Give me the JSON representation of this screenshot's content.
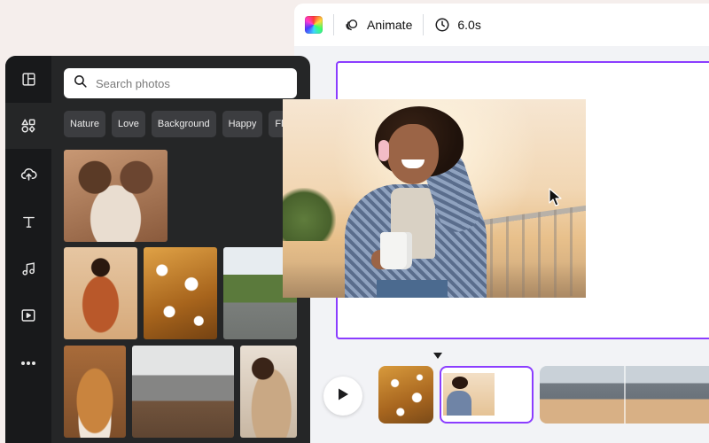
{
  "toolbar": {
    "animate_label": "Animate",
    "duration_label": "6.0s"
  },
  "sidebar": {
    "items": [
      {
        "icon": "layout-icon"
      },
      {
        "icon": "elements-icon",
        "active": true
      },
      {
        "icon": "upload-cloud-icon"
      },
      {
        "icon": "text-icon"
      },
      {
        "icon": "music-icon"
      },
      {
        "icon": "video-icon"
      },
      {
        "icon": "more-icon"
      }
    ]
  },
  "search": {
    "placeholder": "Search photos",
    "value": ""
  },
  "chips": [
    "Nature",
    "Love",
    "Background",
    "Happy",
    "Flowers"
  ],
  "photos": [
    {
      "icon": "family-photo"
    },
    {
      "icon": "woman-orange-outfit-photo"
    },
    {
      "icon": "daisies-photo"
    },
    {
      "icon": "forest-road-photo"
    },
    {
      "icon": "corgi-photo"
    },
    {
      "icon": "mountain-desert-photo"
    },
    {
      "icon": "couple-photo"
    }
  ],
  "colors": {
    "accent": "#8b3dff",
    "panel_bg": "#252627",
    "rail_bg": "#18191b",
    "chip_bg": "#3c3d40",
    "page_bg": "#f5eeec"
  }
}
